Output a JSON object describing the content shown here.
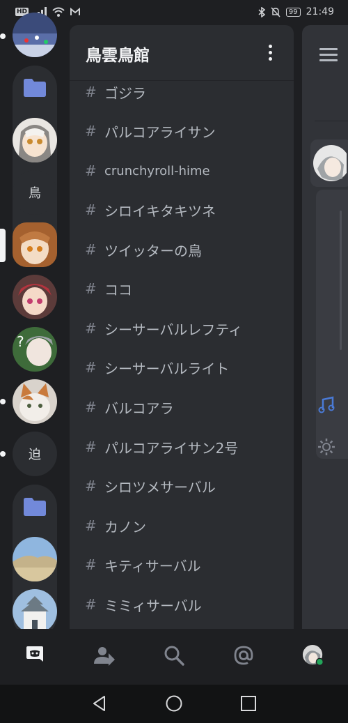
{
  "status_bar": {
    "hd_label": "HD",
    "battery": "99",
    "time": "21:49"
  },
  "server": {
    "name": "鳥雲鳥館"
  },
  "server_rail": {
    "letters": {
      "bird": "鳥",
      "sako": "迫"
    }
  },
  "channels": [
    {
      "hash": "#",
      "name": "ゴジラ"
    },
    {
      "hash": "#",
      "name": "パルコアライサン"
    },
    {
      "hash": "#",
      "name": "crunchyroll-hime"
    },
    {
      "hash": "#",
      "name": "シロイキタキツネ"
    },
    {
      "hash": "#",
      "name": "ツイッターの鳥"
    },
    {
      "hash": "#",
      "name": "ココ"
    },
    {
      "hash": "#",
      "name": "シーサーバルレフティ"
    },
    {
      "hash": "#",
      "name": "シーサーバルライト"
    },
    {
      "hash": "#",
      "name": "バルコアラ"
    },
    {
      "hash": "#",
      "name": "パルコアライサン2号"
    },
    {
      "hash": "#",
      "name": "シロツメサーバル"
    },
    {
      "hash": "#",
      "name": "カノン"
    },
    {
      "hash": "#",
      "name": "キティサーバル"
    },
    {
      "hash": "#",
      "name": "ミミィサーバル"
    }
  ],
  "colors": {
    "background": "#1e1f22",
    "channel_panel": "#2b2d31",
    "chat": "#313338",
    "folder_blurple": "#7289da",
    "online_green": "#23a55a"
  },
  "icons": {
    "bottom_nav": [
      "discord-home-icon",
      "friends-icon",
      "search-icon",
      "mentions-icon",
      "profile-avatar"
    ],
    "system_nav": [
      "back-icon",
      "home-icon",
      "recents-icon"
    ]
  }
}
